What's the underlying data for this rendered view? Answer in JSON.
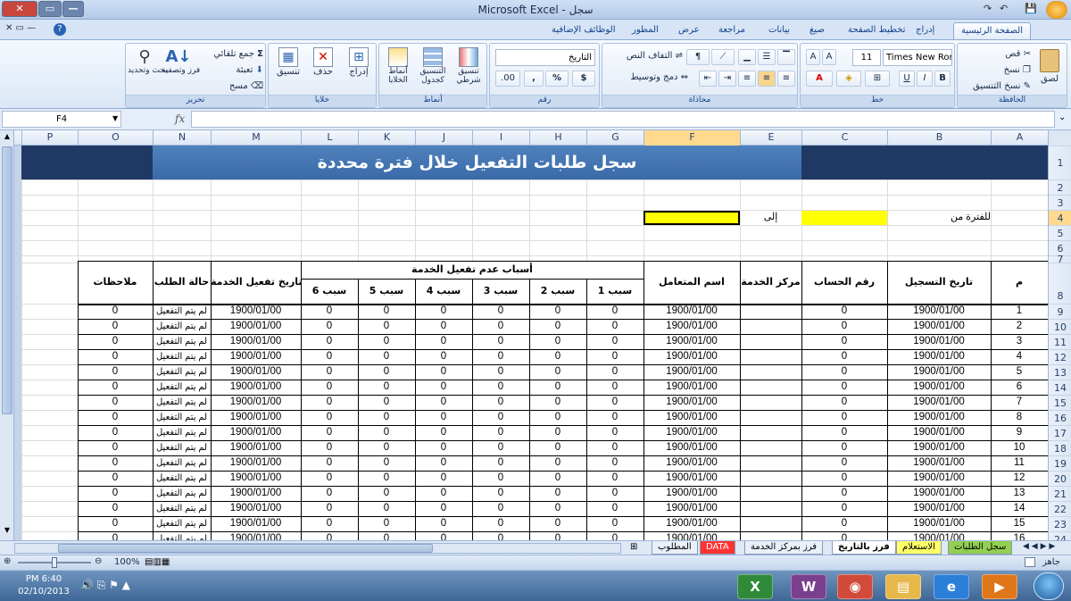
{
  "titlebar": {
    "title": "Microsoft Excel - سجل",
    "quick_save": "💾"
  },
  "ribbon_tabs": [
    "الصفحة الرئيسية",
    "إدراج",
    "تخطيط الصفحة",
    "صيغ",
    "بيانات",
    "مراجعة",
    "عرض",
    "المطور",
    "الوظائف الإضافية"
  ],
  "clipboard": {
    "label": "الحافظة",
    "paste": "لصق",
    "cut": "قص",
    "copy": "نسخ",
    "format_painter": "نسخ التنسيق"
  },
  "font": {
    "label": "خط",
    "name": "Times New Roma",
    "size": "11",
    "bold": "B",
    "italic": "I",
    "underline": "U"
  },
  "alignment": {
    "label": "محاذاة",
    "wrap": "التفاف النص",
    "merge": "دمج وتوسيط"
  },
  "number": {
    "label": "رقم",
    "format": "التاريخ",
    "currency": "$",
    "percent": "%",
    "comma": ",",
    "inc_dec": ".00",
    "dec_dec": ".0"
  },
  "styles": {
    "label": "أنماط",
    "conditional": "تنسيق شرطي",
    "table": "التنسيق كجدول",
    "cell": "أنماط الخلايا"
  },
  "cells": {
    "label": "خلايا",
    "insert": "إدراج",
    "delete": "حذف",
    "format": "تنسيق"
  },
  "editing": {
    "label": "تحرير",
    "autosum": "جمع تلقائي",
    "fill": "تعبئة",
    "clear": "مسح",
    "sort": "فرز وتصفية",
    "find": "بحث وتحديد"
  },
  "formula_bar": {
    "namebox": "F4",
    "fx": "fx",
    "value": ""
  },
  "columns": [
    "A",
    "B",
    "C",
    "E",
    "F",
    "G",
    "H",
    "I",
    "J",
    "K",
    "L",
    "M",
    "N",
    "O",
    "P"
  ],
  "sheet": {
    "title": "سجل طلبات التفعيل خلال فترة محددة",
    "period_from": "للفترة من",
    "to": "إلى",
    "headers": {
      "m": "م",
      "reg_date": "تاريخ التسجيل",
      "account": "رقم الحساب",
      "center": "مركز الخدمة",
      "customer": "اسم المتعامل",
      "reasons": "أسباب عدم تفعيل الخدمة",
      "r1": "سبب 1",
      "r2": "سبب 2",
      "r3": "سبب 3",
      "r4": "سبب 4",
      "r5": "سبب 5",
      "r6": "سبب 6",
      "act_date": "تاريخ تفعيل الخدمة",
      "status": "حالة الطلب",
      "notes": "ملاحظات"
    },
    "row_date": "1900/01/00",
    "row_zero": "0",
    "row_status": "لم يتم التفعيل",
    "rows": [
      "1",
      "2",
      "3",
      "4",
      "5",
      "6",
      "7",
      "8",
      "9",
      "10",
      "11",
      "12",
      "13",
      "14",
      "15",
      "16"
    ]
  },
  "row_numbers": [
    "1",
    "2",
    "3",
    "4",
    "5",
    "6",
    "7",
    "8",
    "9",
    "10",
    "11",
    "12",
    "13",
    "14",
    "15",
    "16",
    "17",
    "18",
    "19",
    "20",
    "21",
    "22",
    "23",
    "24"
  ],
  "sheet_tabs": [
    "سجل الطلبات",
    "الاستعلام",
    "فرز بالتاريخ",
    "فرز بمركز الخدمة",
    "DATA",
    "المطلوب"
  ],
  "status": {
    "ready": "جاهز",
    "zoom": "100%"
  },
  "taskbar": {
    "time": "PM 6:40",
    "date": "02/10/2013",
    "apps": [
      "X",
      "W",
      "◉",
      "▤",
      "e",
      "▶"
    ]
  },
  "colors": {
    "title_band": "#1f3864",
    "title_bar": "#4f81bd",
    "yellow": "#ffff00",
    "tab_yellow": "#ffff66",
    "tab_red": "#ff3333",
    "tab_green": "#92d050"
  }
}
